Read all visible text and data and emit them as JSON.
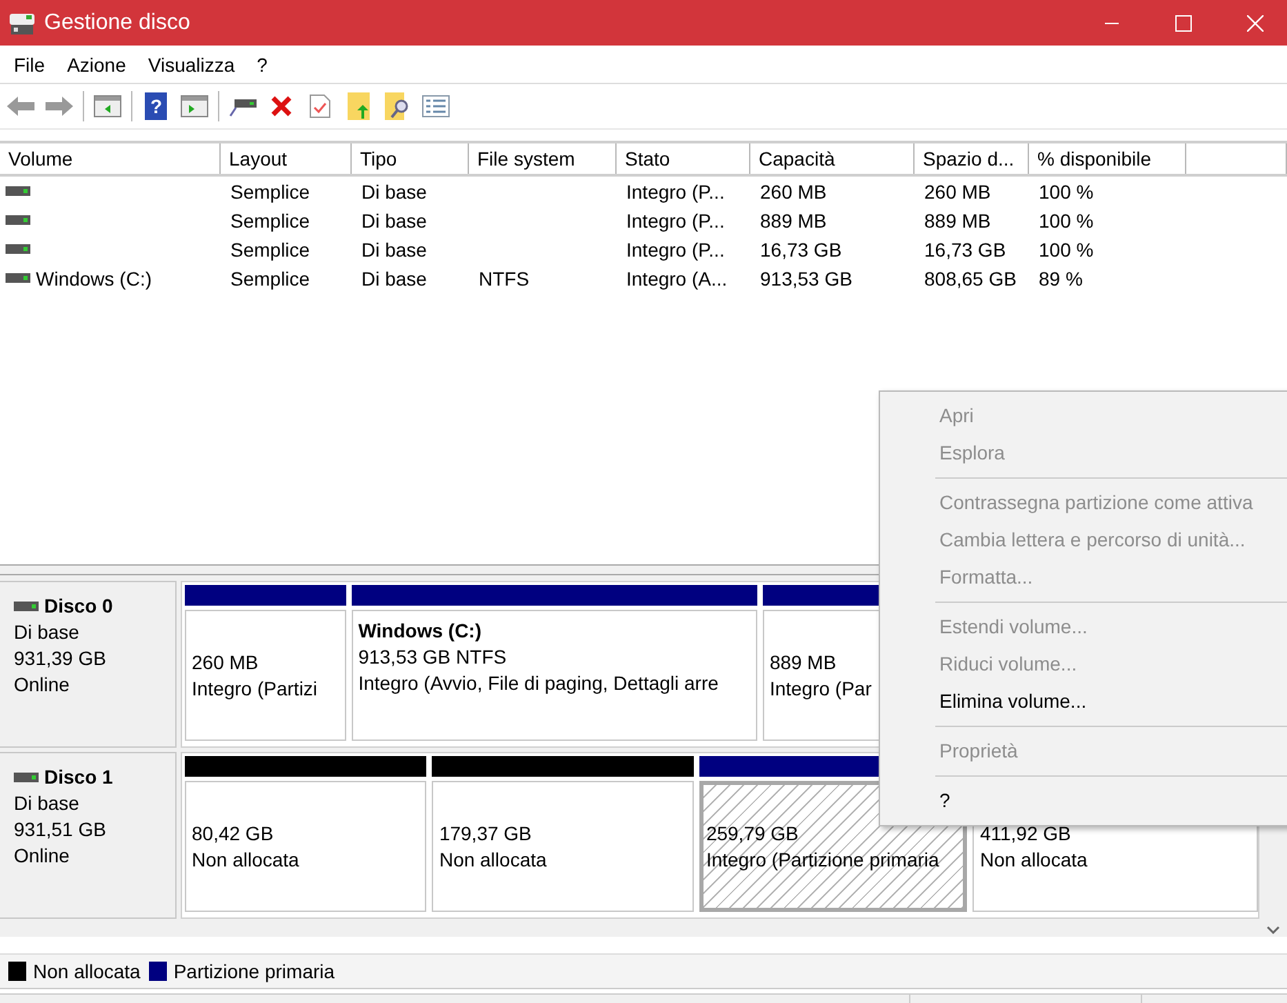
{
  "window": {
    "title": "Gestione disco"
  },
  "menu_bar": [
    "File",
    "Azione",
    "Visualizza",
    "?"
  ],
  "toolbar": {
    "help_glyph": "?"
  },
  "table": {
    "columns": [
      "Volume",
      "Layout",
      "Tipo",
      "File system",
      "Stato",
      "Capacità",
      "Spazio d...",
      "% disponibile"
    ],
    "rows": [
      {
        "volume": "",
        "layout": "Semplice",
        "tipo": "Di base",
        "file_system": "",
        "stato": "Integro (P...",
        "capacita": "260 MB",
        "spazio": "260 MB",
        "percent": "100 %"
      },
      {
        "volume": "",
        "layout": "Semplice",
        "tipo": "Di base",
        "file_system": "",
        "stato": "Integro (P...",
        "capacita": "889 MB",
        "spazio": "889 MB",
        "percent": "100 %"
      },
      {
        "volume": "",
        "layout": "Semplice",
        "tipo": "Di base",
        "file_system": "",
        "stato": "Integro (P...",
        "capacita": "16,73 GB",
        "spazio": "16,73 GB",
        "percent": "100 %"
      },
      {
        "volume": "Windows (C:)",
        "layout": "Semplice",
        "tipo": "Di base",
        "file_system": "NTFS",
        "stato": "Integro (A...",
        "capacita": "913,53 GB",
        "spazio": "808,65 GB",
        "percent": "89 %"
      }
    ]
  },
  "disks": [
    {
      "name": "Disco 0",
      "type": "Di base",
      "size": "931,39 GB",
      "status": "Online",
      "partitions": [
        {
          "kind": "primary",
          "selected": false,
          "lines": [
            "260 MB",
            "Integro (Partizi"
          ]
        },
        {
          "kind": "primary",
          "selected": false,
          "title": "Windows  (C:)",
          "lines": [
            "913,53 GB NTFS",
            "Integro (Avvio, File di paging, Dettagli arre"
          ]
        },
        {
          "kind": "primary",
          "selected": false,
          "lines": [
            "889 MB",
            "Integro (Par"
          ]
        }
      ]
    },
    {
      "name": "Disco 1",
      "type": "Di base",
      "size": "931,51 GB",
      "status": "Online",
      "partitions": [
        {
          "kind": "unallocated",
          "selected": false,
          "lines": [
            "80,42 GB",
            "Non allocata"
          ]
        },
        {
          "kind": "unallocated",
          "selected": false,
          "lines": [
            "179,37 GB",
            "Non allocata"
          ]
        },
        {
          "kind": "primary",
          "selected": true,
          "lines": [
            "259,79 GB",
            "Integro (Partizione primaria"
          ]
        },
        {
          "selected": false,
          "lines": [
            "411,92 GB",
            "Non allocata"
          ]
        }
      ]
    }
  ],
  "legend": [
    {
      "label": "Non allocata",
      "color": "#000000"
    },
    {
      "label": "Partizione primaria",
      "color": "#000080"
    }
  ],
  "context_menu": {
    "groups": [
      [
        {
          "label": "Apri",
          "disabled": true
        },
        {
          "label": "Esplora",
          "disabled": true
        }
      ],
      [
        {
          "label": "Contrassegna partizione come attiva",
          "disabled": true
        },
        {
          "label": "Cambia lettera e percorso di unità...",
          "disabled": true
        },
        {
          "label": "Formatta...",
          "disabled": true
        }
      ],
      [
        {
          "label": "Estendi volume...",
          "disabled": true
        },
        {
          "label": "Riduci volume...",
          "disabled": true
        },
        {
          "label": "Elimina volume...",
          "disabled": false
        }
      ],
      [
        {
          "label": "Proprietà",
          "disabled": true
        }
      ],
      [
        {
          "label": "?",
          "disabled": false
        }
      ]
    ]
  }
}
